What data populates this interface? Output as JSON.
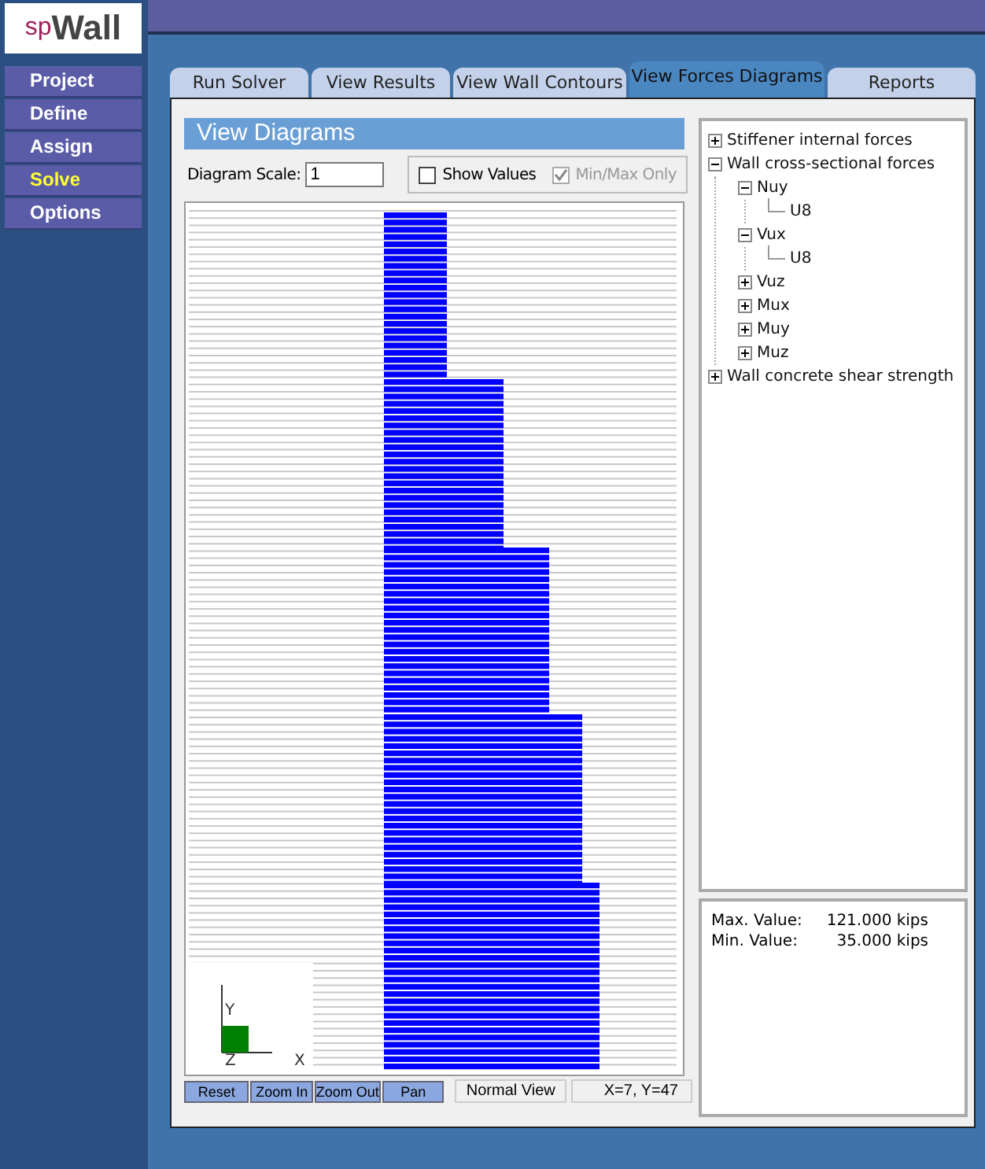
{
  "logo": {
    "text": "spWall"
  },
  "menu": [
    {
      "label": "Project",
      "selected": false
    },
    {
      "label": "Define",
      "selected": false
    },
    {
      "label": "Assign",
      "selected": false
    },
    {
      "label": "Solve",
      "selected": true
    },
    {
      "label": "Options",
      "selected": false
    }
  ],
  "tabs": [
    {
      "label": "Run Solver",
      "selected": false
    },
    {
      "label": "View Results",
      "selected": false
    },
    {
      "label": "View Wall Contours",
      "selected": false
    },
    {
      "label": "View Forces Diagrams",
      "selected": true
    },
    {
      "label": "Reports",
      "selected": false
    }
  ],
  "panel_title": "View Diagrams",
  "scale": {
    "label": "Diagram Scale:",
    "value": "1"
  },
  "checkboxes": [
    {
      "label": "Show Values",
      "checked": false,
      "disabled": false
    },
    {
      "label": "Min/Max Only",
      "checked": true,
      "disabled": true
    }
  ],
  "axes": {
    "y": "Y",
    "z": "Z",
    "x": "X"
  },
  "view_buttons": [
    "Reset",
    "Zoom In",
    "Zoom Out",
    "Pan"
  ],
  "status": [
    {
      "text": "Normal View"
    },
    {
      "text": "X=7, Y=47"
    }
  ],
  "tree": [
    {
      "label": "Stiffener internal forces",
      "expanded": false
    },
    {
      "label": "Wall cross-sectional forces",
      "expanded": true,
      "children": [
        {
          "label": "Nuy",
          "expanded": true,
          "children": [
            {
              "label": "U8"
            }
          ]
        },
        {
          "label": "Vux",
          "expanded": true,
          "children": [
            {
              "label": "U8"
            }
          ]
        },
        {
          "label": "Vuz",
          "expanded": false
        },
        {
          "label": "Mux",
          "expanded": false
        },
        {
          "label": "Muy",
          "expanded": false
        },
        {
          "label": "Muz",
          "expanded": false
        }
      ]
    },
    {
      "label": "Wall concrete shear strength",
      "expanded": false
    }
  ],
  "values": [
    {
      "label": "Max. Value:",
      "value": "121.000 kips"
    },
    {
      "label": "Min. Value:",
      "value": "35.000 kips"
    }
  ]
}
